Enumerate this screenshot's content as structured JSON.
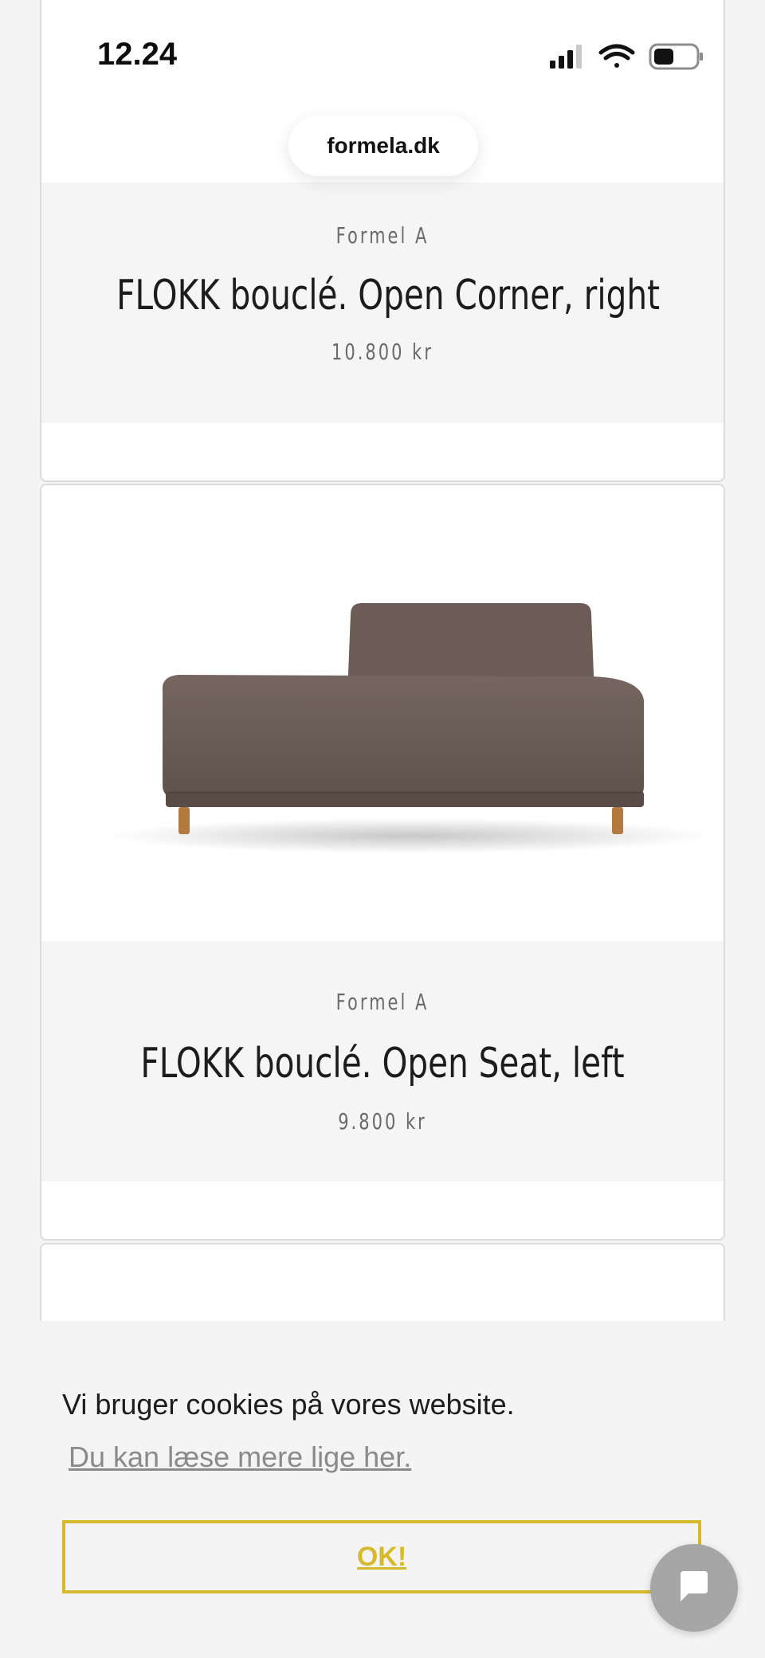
{
  "status_bar": {
    "time": "12.24"
  },
  "browser": {
    "url": "formela.dk"
  },
  "products": [
    {
      "brand": "Formel A",
      "name": "FLOKK bouclé. Open Corner, right",
      "price": "10.800 kr"
    },
    {
      "brand": "Formel A",
      "name": "FLOKK bouclé. Open Seat, left",
      "price": "9.800 kr"
    }
  ],
  "cookie_banner": {
    "text": "Vi bruger cookies på vores website.",
    "link": "Du kan læse mere lige her.",
    "ok_label": "OK!"
  },
  "colors": {
    "accent": "#d6b92c",
    "sofa": "#6a5c55"
  },
  "icons": [
    "signal-icon",
    "wifi-icon",
    "battery-icon",
    "chat-icon"
  ]
}
